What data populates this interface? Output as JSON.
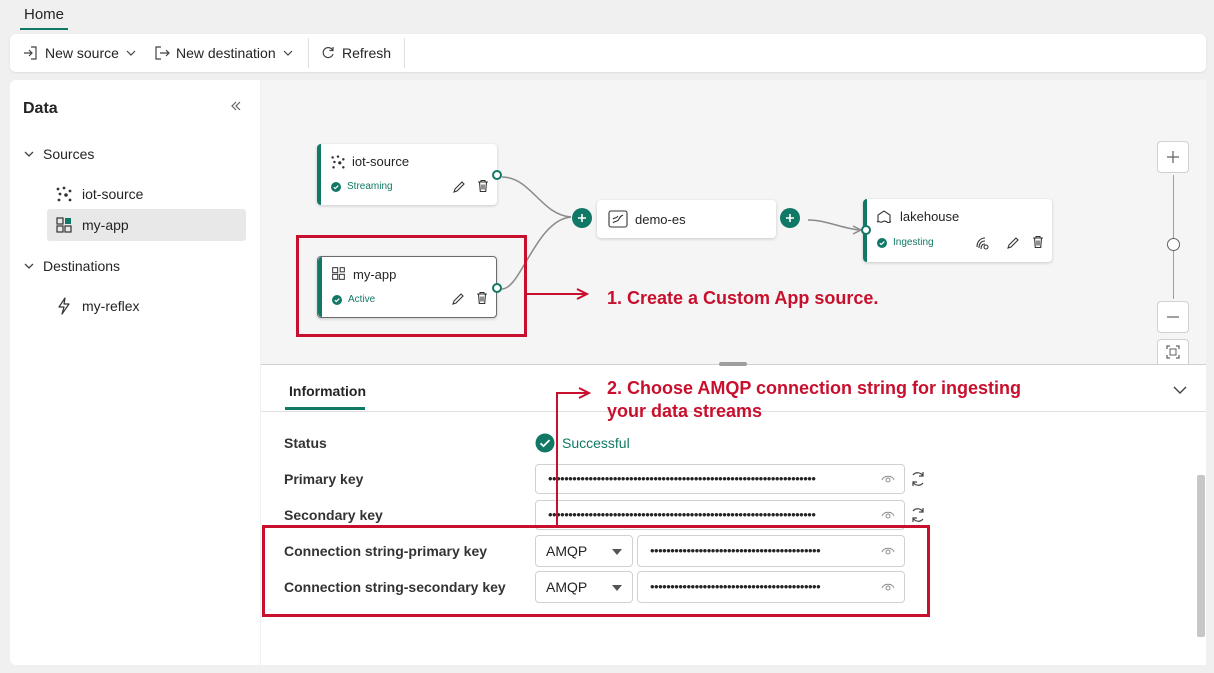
{
  "tabs": {
    "home": "Home"
  },
  "toolbar": {
    "new_source": "New source",
    "new_destination": "New destination",
    "refresh": "Refresh"
  },
  "sidebar": {
    "title": "Data",
    "sources_label": "Sources",
    "sources": [
      {
        "label": "iot-source",
        "icon": "iot-source-icon"
      },
      {
        "label": "my-app",
        "icon": "custom-app-icon"
      }
    ],
    "destinations_label": "Destinations",
    "destinations": [
      {
        "label": "my-reflex",
        "icon": "reflex-icon"
      }
    ]
  },
  "canvas": {
    "nodes": {
      "iot_source": {
        "title": "iot-source",
        "status": "Streaming"
      },
      "my_app": {
        "title": "my-app",
        "status": "Active"
      },
      "stream": {
        "title": "demo-es"
      },
      "lakehouse": {
        "title": "lakehouse",
        "status": "Ingesting"
      }
    }
  },
  "info": {
    "tab": "Information",
    "status_label": "Status",
    "status_value": "Successful",
    "primary_key_label": "Primary key",
    "primary_key_value": "••••••••••••••••••••••••••••••••••••••••••••••••••••••••••••••••••",
    "secondary_key_label": "Secondary key",
    "secondary_key_value": "••••••••••••••••••••••••••••••••••••••••••••••••••••••••••••••••••",
    "conn_primary_label": "Connection string-primary key",
    "conn_primary_protocol": "AMQP",
    "conn_primary_value": "••••••••••••••••••••••••••••••••••••••••••",
    "conn_secondary_label": "Connection string-secondary key",
    "conn_secondary_protocol": "AMQP",
    "conn_secondary_value": "••••••••••••••••••••••••••••••••••••••••••"
  },
  "annotations": {
    "step1": "1. Create a Custom App source.",
    "step2_line1": "2. Choose AMQP connection string for ingesting",
    "step2_line2": "your data streams"
  },
  "colors": {
    "accent": "#117865",
    "annotation": "#c8102e"
  }
}
